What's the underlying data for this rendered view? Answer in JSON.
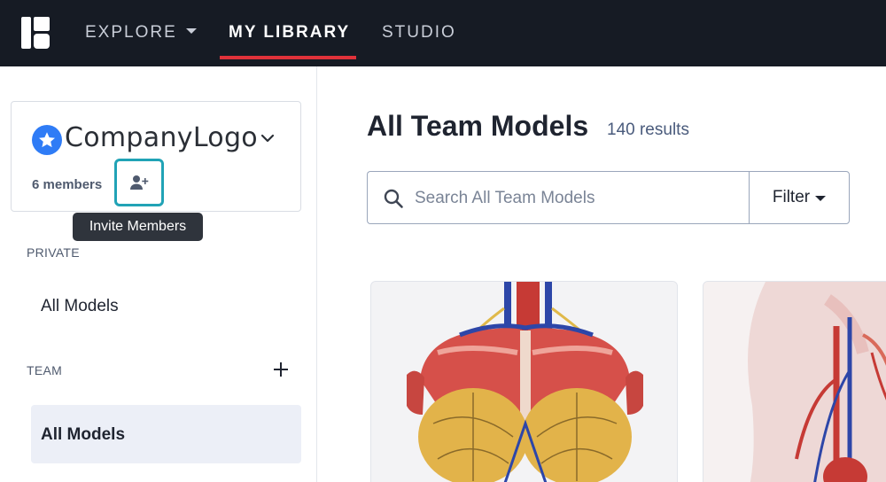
{
  "nav": {
    "explore": "EXPLORE",
    "my_library": "MY LIBRARY",
    "studio": "STUDIO"
  },
  "team": {
    "name": "CompanyLogo",
    "members": "6 members",
    "invite_tooltip": "Invite Members"
  },
  "sidebar": {
    "private_label": "PRIVATE",
    "private_all_models": "All Models",
    "team_label": "TEAM",
    "team_all_models": "All Models"
  },
  "main": {
    "title": "All Team Models",
    "result_count": "140 results",
    "search_placeholder": "Search All Team Models",
    "filter_label": "Filter"
  },
  "colors": {
    "nav_bg": "#161b24",
    "accent_red": "#e0323a",
    "highlight_teal": "#21a3b6",
    "brand_blue": "#2f7cf6"
  }
}
